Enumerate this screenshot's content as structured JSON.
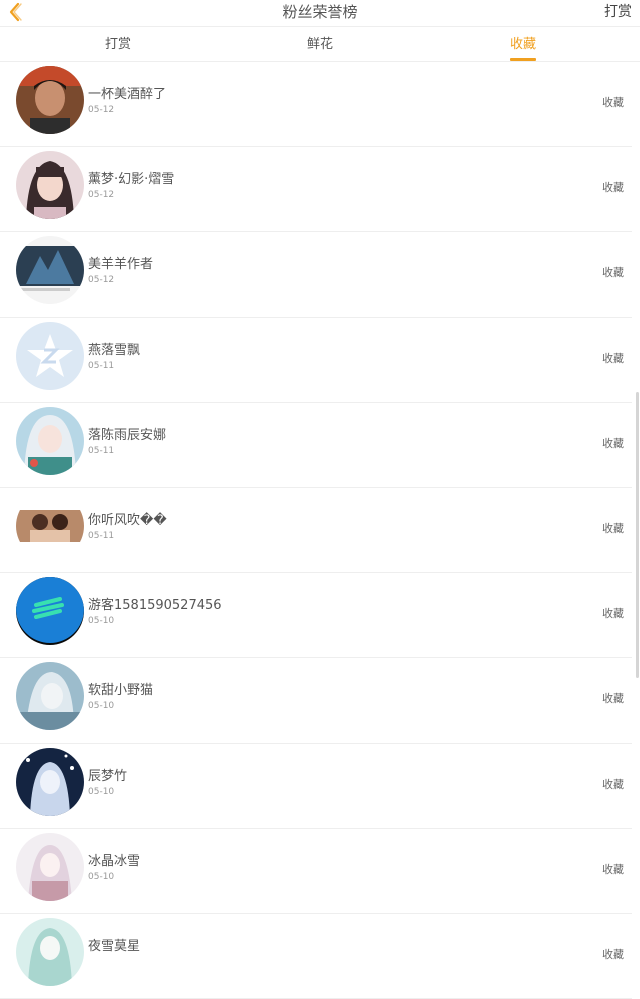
{
  "header": {
    "title": "粉丝荣誉榜",
    "action_label": "打赏",
    "accent": "#f0a020"
  },
  "tabs": [
    {
      "label": "打赏",
      "active": false
    },
    {
      "label": "鲜花",
      "active": false
    },
    {
      "label": "收藏",
      "active": true
    }
  ],
  "fans": [
    {
      "name": "一杯美酒醉了",
      "date": "05-12",
      "gift": "收藏",
      "avatar": "photo-man"
    },
    {
      "name": "薰梦·幻影·熠雪",
      "date": "05-12",
      "gift": "收藏",
      "avatar": "photo-girl"
    },
    {
      "name": "美羊羊作者",
      "date": "05-12",
      "gift": "收藏",
      "avatar": "screenshot"
    },
    {
      "name": "燕落雪飘",
      "date": "05-11",
      "gift": "收藏",
      "avatar": "qzone-default"
    },
    {
      "name": "落陈雨辰安娜",
      "date": "05-11",
      "gift": "收藏",
      "avatar": "anime-girl"
    },
    {
      "name": "你听风吹��",
      "date": "05-11",
      "gift": "收藏",
      "avatar": "photo-couple"
    },
    {
      "name": "游客1581590527456",
      "date": "05-10",
      "gift": "收藏",
      "avatar": "blue-logo"
    },
    {
      "name": "软甜小野猫",
      "date": "05-10",
      "gift": "收藏",
      "avatar": "anime-blue"
    },
    {
      "name": "辰梦竹",
      "date": "05-10",
      "gift": "收藏",
      "avatar": "anime-night"
    },
    {
      "name": "冰晶冰雪",
      "date": "05-10",
      "gift": "收藏",
      "avatar": "anime-pink"
    },
    {
      "name": "夜雪莫星",
      "date": "",
      "gift": "收藏",
      "avatar": "anime-teal"
    }
  ]
}
